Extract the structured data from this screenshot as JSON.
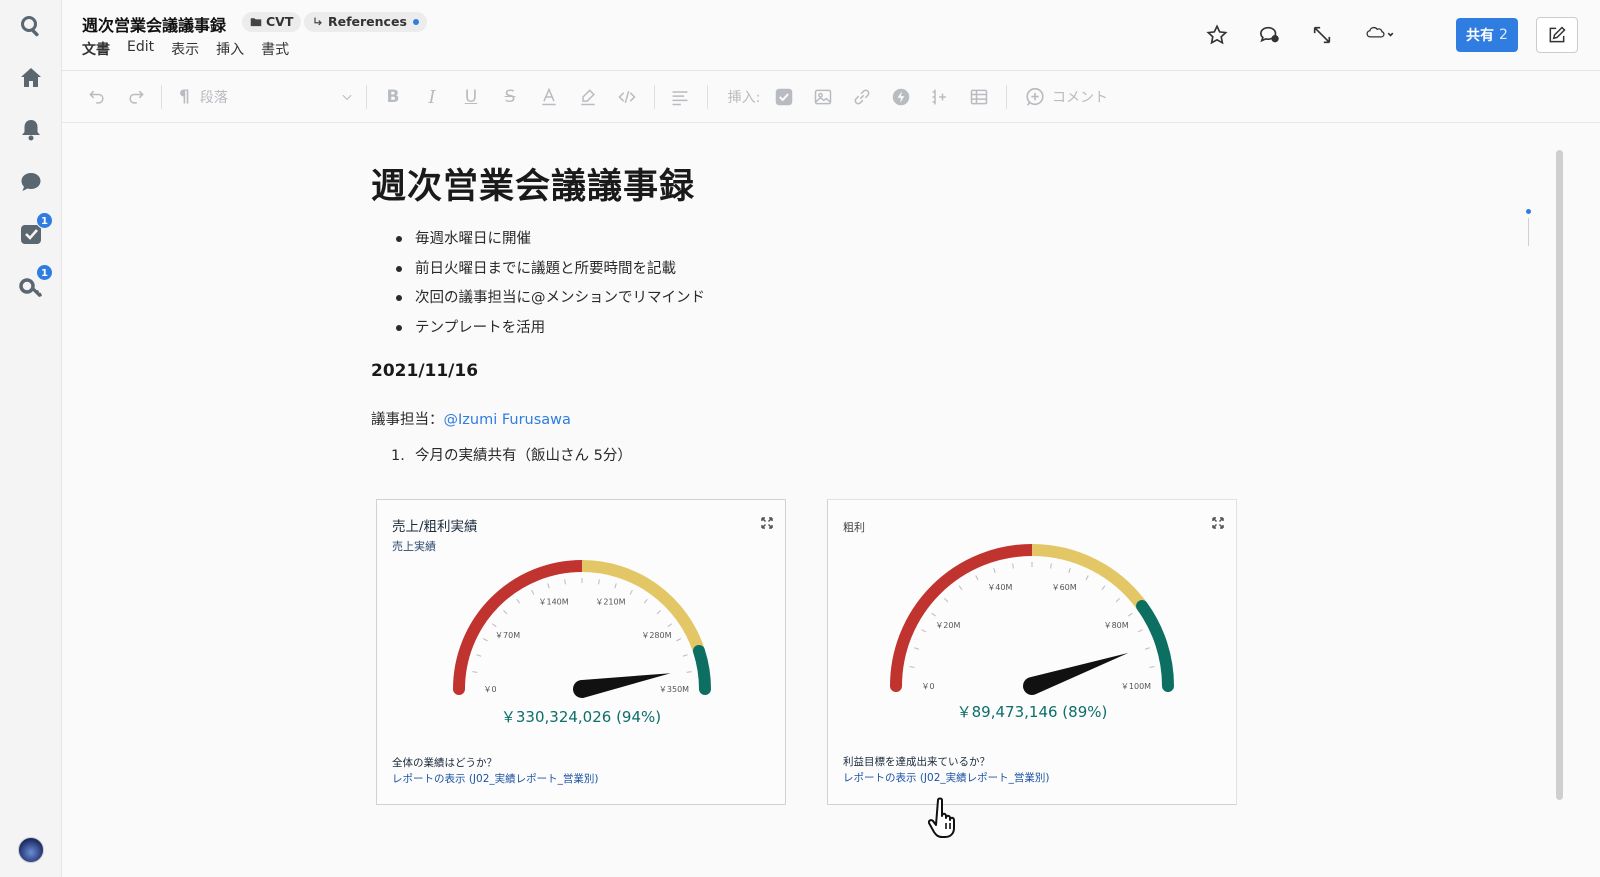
{
  "header": {
    "title": "週次営業会議議事録",
    "chips": [
      {
        "label": "CVT",
        "icon": "folder-icon"
      },
      {
        "label": "References",
        "icon": "link-arrow-icon"
      }
    ],
    "menu": [
      "文書",
      "Edit",
      "表示",
      "挿入",
      "書式"
    ],
    "share_label": "共有",
    "share_count": "2",
    "icons": [
      "star-icon",
      "chat-icon",
      "resize-icon",
      "cloud-icon"
    ]
  },
  "rail": {
    "items": [
      {
        "name": "search-icon"
      },
      {
        "name": "home-icon"
      },
      {
        "name": "bell-icon"
      },
      {
        "name": "chat-bubble-icon"
      },
      {
        "name": "task-check-icon",
        "badge": "1"
      },
      {
        "name": "key-icon",
        "badge": "1"
      }
    ]
  },
  "toolbar": {
    "paragraph_label": "段落",
    "insert_label": "挿入:",
    "comment_label": "コメント"
  },
  "document": {
    "title": "週次営業会議議事録",
    "bullets": [
      "毎週水曜日に開催",
      "前日火曜日までに議題と所要時間を記載",
      "次回の議事担当に@メンションでリマインド",
      "テンプレートを活用"
    ],
    "date": "2021/11/16",
    "owner_label": "議事担当：",
    "owner_mention": "@Izumi Furusawa",
    "ordered": [
      {
        "num": "1.",
        "text": "今月の実績共有（飯山さん 5分）"
      }
    ]
  },
  "chart_data": [
    {
      "type": "gauge",
      "title": "売上/粗利実績",
      "subtitle": "売上実績",
      "value": 330324026,
      "value_label": "￥330,324,026 (94%)",
      "min": 0,
      "max": 350000000,
      "ticks": [
        "￥0",
        "￥70M",
        "￥140M",
        "￥210M",
        "￥280M",
        "￥350M"
      ],
      "bands": [
        {
          "from": 0,
          "to": 175000000,
          "color": "#c0332e"
        },
        {
          "from": 175000000,
          "to": 315000000,
          "color": "#e3c766"
        },
        {
          "from": 315000000,
          "to": 350000000,
          "color": "#0d6e62"
        }
      ],
      "question": "全体の業績はどうか？",
      "link": "レポートの表示 (J02_実績レポート_営業別)"
    },
    {
      "type": "gauge",
      "title": "粗利",
      "value": 89473146,
      "value_label": "￥89,473,146 (89%)",
      "min": 0,
      "max": 100000000,
      "ticks": [
        "￥0",
        "￥20M",
        "￥40M",
        "￥60M",
        "￥80M",
        "￥100M"
      ],
      "bands": [
        {
          "from": 0,
          "to": 50000000,
          "color": "#c0332e"
        },
        {
          "from": 50000000,
          "to": 80000000,
          "color": "#e3c766"
        },
        {
          "from": 80000000,
          "to": 100000000,
          "color": "#0d6e62"
        }
      ],
      "question": "利益目標を達成出来ているか？",
      "link": "レポートの表示 (J02_実績レポート_営業別)"
    }
  ]
}
